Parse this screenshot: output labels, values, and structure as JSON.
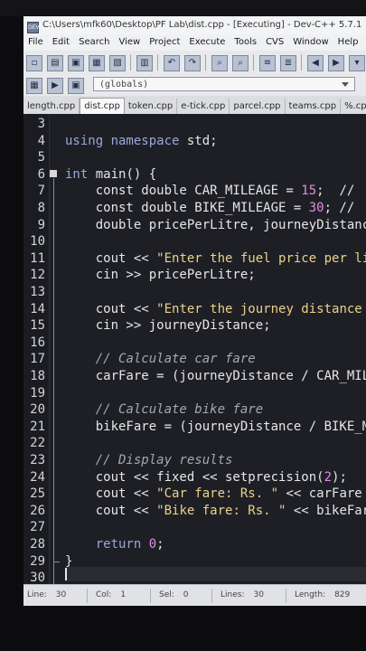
{
  "window": {
    "title": "C:\\Users\\mfk60\\Desktop\\PF Lab\\dist.cpp - [Executing] - Dev-C++ 5.7.1",
    "icon_label": "DEV"
  },
  "menu": [
    "File",
    "Edit",
    "Search",
    "View",
    "Project",
    "Execute",
    "Tools",
    "CVS",
    "Window",
    "Help"
  ],
  "scope_select": {
    "value": "(globals)"
  },
  "tabs": [
    "length.cpp",
    "dist.cpp",
    "token.cpp",
    "e-tick.cpp",
    "parcel.cpp",
    "teams.cpp",
    "%.cpp"
  ],
  "active_tab": "dist.cpp",
  "editor": {
    "lines": [
      {
        "n": "3",
        "tokens": []
      },
      {
        "n": "4",
        "tokens": [
          [
            "kw",
            "using namespace"
          ],
          [
            "txt",
            " std;"
          ]
        ]
      },
      {
        "n": "5",
        "tokens": []
      },
      {
        "n": "6",
        "tokens": [
          [
            "kw",
            "int"
          ],
          [
            "txt",
            " main() {"
          ]
        ]
      },
      {
        "n": "7",
        "tokens": [
          [
            "txt",
            "    const double CAR_MILEAGE = "
          ],
          [
            "num",
            "15"
          ],
          [
            "txt",
            ";  //"
          ]
        ]
      },
      {
        "n": "8",
        "tokens": [
          [
            "txt",
            "    const double BIKE_MILEAGE = "
          ],
          [
            "num",
            "30"
          ],
          [
            "txt",
            "; //"
          ]
        ]
      },
      {
        "n": "9",
        "tokens": [
          [
            "txt",
            "    double pricePerLitre, journeyDistance"
          ]
        ]
      },
      {
        "n": "10",
        "tokens": []
      },
      {
        "n": "11",
        "tokens": [
          [
            "txt",
            "    cout << "
          ],
          [
            "str",
            "\"Enter the fuel price per li"
          ]
        ]
      },
      {
        "n": "12",
        "tokens": [
          [
            "txt",
            "    cin >> pricePerLitre;"
          ]
        ]
      },
      {
        "n": "13",
        "tokens": []
      },
      {
        "n": "14",
        "tokens": [
          [
            "txt",
            "    cout << "
          ],
          [
            "str",
            "\"Enter the journey distance"
          ]
        ]
      },
      {
        "n": "15",
        "tokens": [
          [
            "txt",
            "    cin >> journeyDistance;"
          ]
        ]
      },
      {
        "n": "16",
        "tokens": []
      },
      {
        "n": "17",
        "tokens": [
          [
            "cmt",
            "    // Calculate car fare"
          ]
        ]
      },
      {
        "n": "18",
        "tokens": [
          [
            "txt",
            "    carFare = (journeyDistance / CAR_MIL"
          ]
        ]
      },
      {
        "n": "19",
        "tokens": []
      },
      {
        "n": "20",
        "tokens": [
          [
            "cmt",
            "    // Calculate bike fare"
          ]
        ]
      },
      {
        "n": "21",
        "tokens": [
          [
            "txt",
            "    bikeFare = (journeyDistance / BIKE_M"
          ]
        ]
      },
      {
        "n": "22",
        "tokens": []
      },
      {
        "n": "23",
        "tokens": [
          [
            "cmt",
            "    // Display results"
          ]
        ]
      },
      {
        "n": "24",
        "tokens": [
          [
            "txt",
            "    cout << fixed << setprecision("
          ],
          [
            "num",
            "2"
          ],
          [
            "txt",
            ");"
          ]
        ]
      },
      {
        "n": "25",
        "tokens": [
          [
            "txt",
            "    cout << "
          ],
          [
            "str",
            "\"Car fare: Rs. \""
          ],
          [
            "txt",
            " << carFare"
          ]
        ]
      },
      {
        "n": "26",
        "tokens": [
          [
            "txt",
            "    cout << "
          ],
          [
            "str",
            "\"Bike fare: Rs. \""
          ],
          [
            "txt",
            " << bikeFar"
          ]
        ]
      },
      {
        "n": "27",
        "tokens": []
      },
      {
        "n": "28",
        "tokens": [
          [
            "txt",
            "    "
          ],
          [
            "kw",
            "return"
          ],
          [
            "txt",
            " "
          ],
          [
            "num",
            "0"
          ],
          [
            "txt",
            ";"
          ]
        ]
      },
      {
        "n": "29",
        "tokens": [
          [
            "txt",
            "}"
          ]
        ]
      },
      {
        "n": "30",
        "tokens": []
      }
    ]
  },
  "status": {
    "line_label": "Line:",
    "line_value": "30",
    "col_label": "Col:",
    "col_value": "1",
    "sel_label": "Sel:",
    "sel_value": "0",
    "lines_label": "Lines:",
    "lines_value": "30",
    "length_label": "Length:",
    "length_value": "829"
  },
  "colors": {
    "editor_bg": "#1e1f25",
    "keyword": "#9aa8d8",
    "number": "#e08de0",
    "string": "#ead28a",
    "comment": "#a6a6b8"
  }
}
